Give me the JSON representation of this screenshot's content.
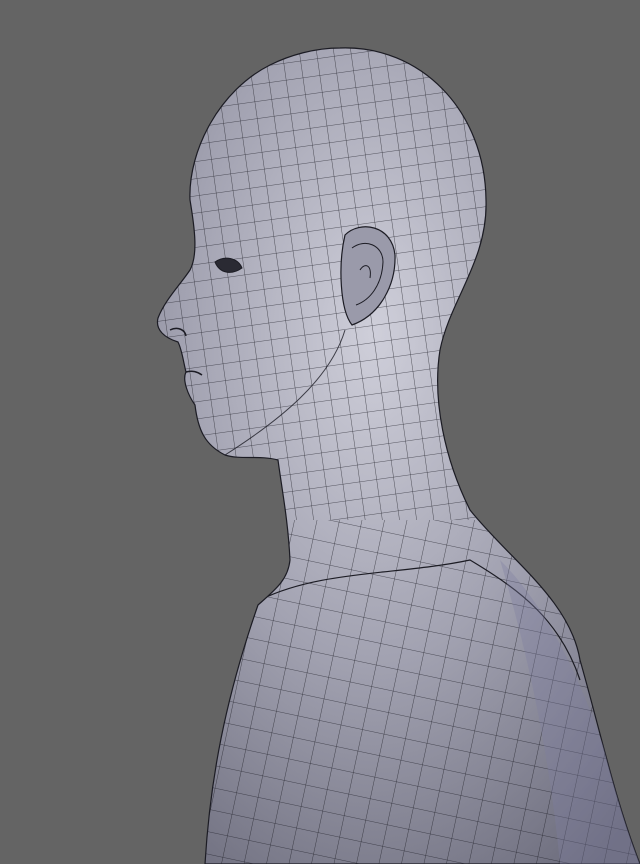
{
  "colors": {
    "background": "#646464",
    "mesh_light": "#c9c9d4",
    "mesh_mid": "#9c9cab",
    "mesh_dark": "#5f5f6e",
    "wire": "#1c1c24"
  }
}
